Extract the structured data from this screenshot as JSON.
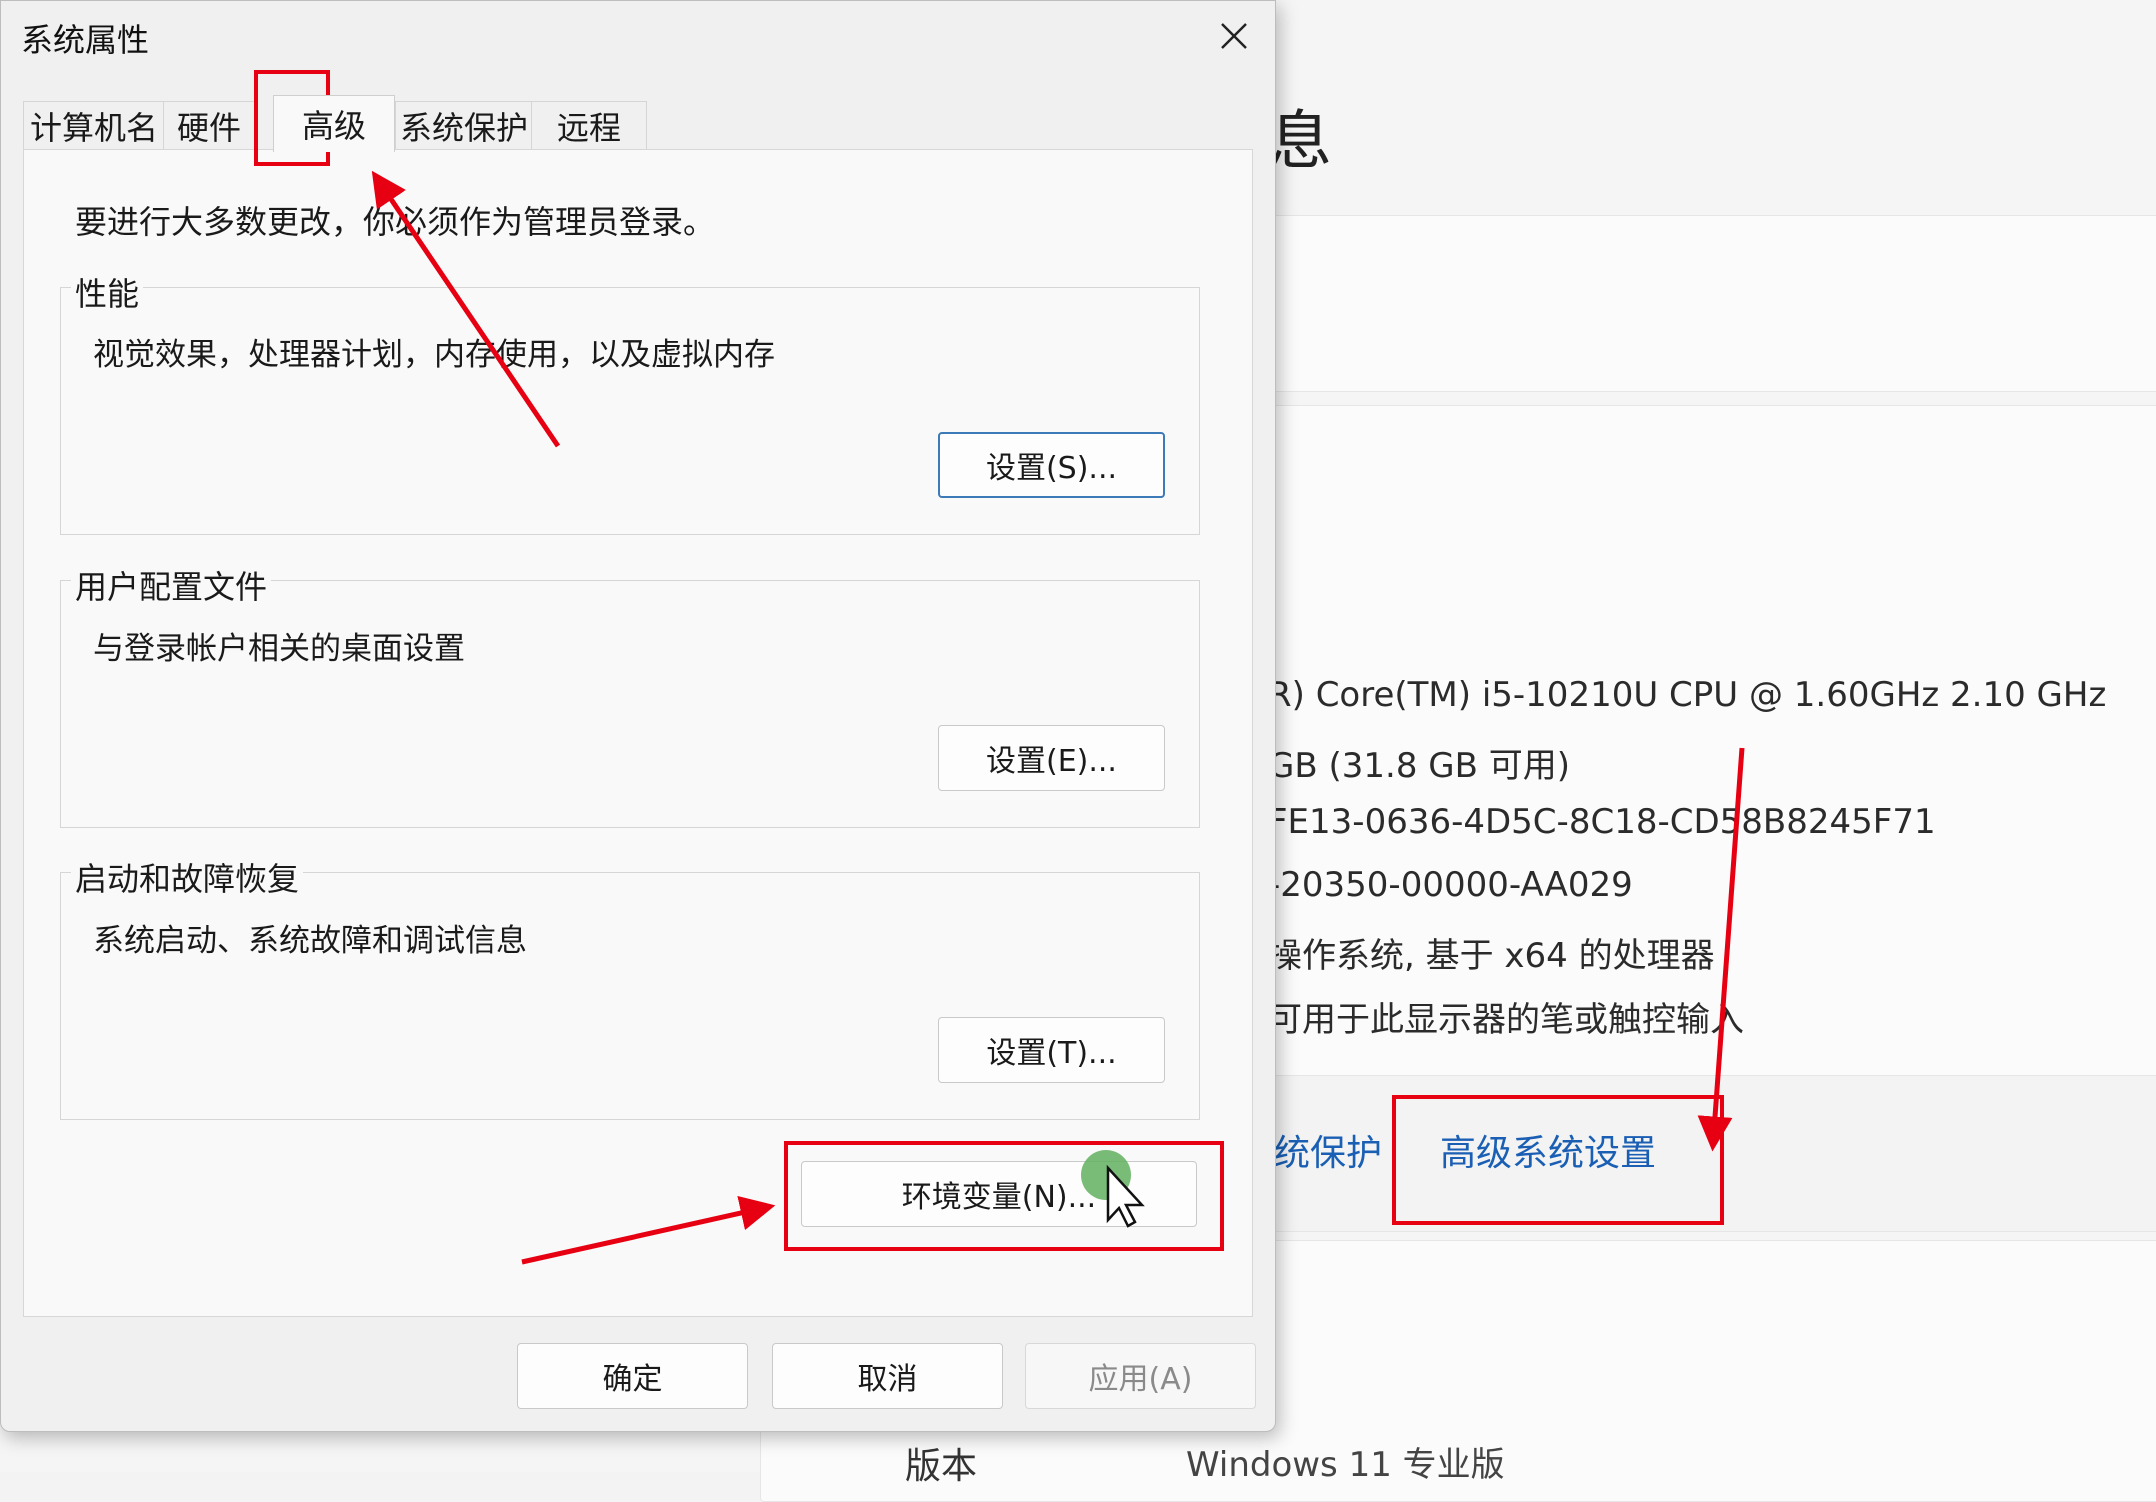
{
  "background": {
    "title_glyph": "息",
    "specs": [
      "R) Core(TM) i5-10210U CPU @ 1.60GHz   2.10 GHz",
      "GB (31.8 GB 可用)",
      "FE13-0636-4D5C-8C18-CD58B8245F71",
      "-20350-00000-AA029",
      "操作系统, 基于 x64 的处理器",
      "可用于此显示器的笔或触控输入"
    ],
    "links": {
      "system_protection": "统保护",
      "advanced_settings": "高级系统设置"
    },
    "footer": {
      "label": "版本",
      "value": "Windows 11 专业版"
    }
  },
  "dialog": {
    "title": "系统属性",
    "tabs": [
      "计算机名",
      "硬件",
      "高级",
      "系统保护",
      "远程"
    ],
    "active_tab": "高级",
    "note": "要进行大多数更改，你必须作为管理员登录。",
    "groups": {
      "performance": {
        "label": "性能",
        "desc": "视觉效果，处理器计划，内存使用，以及虚拟内存",
        "button": "设置(S)..."
      },
      "profiles": {
        "label": "用户配置文件",
        "desc": "与登录帐户相关的桌面设置",
        "button": "设置(E)..."
      },
      "startup": {
        "label": "启动和故障恢复",
        "desc": "系统启动、系统故障和调试信息",
        "button": "设置(T)..."
      }
    },
    "env_button": "环境变量(N)...",
    "footer_buttons": {
      "ok": "确定",
      "cancel": "取消",
      "apply": "应用(A)"
    }
  },
  "colors": {
    "annotation_red": "#e60012",
    "link_blue": "#1a5fb4",
    "focus_blue": "#3d7ab8",
    "click_green": "#60b060"
  }
}
